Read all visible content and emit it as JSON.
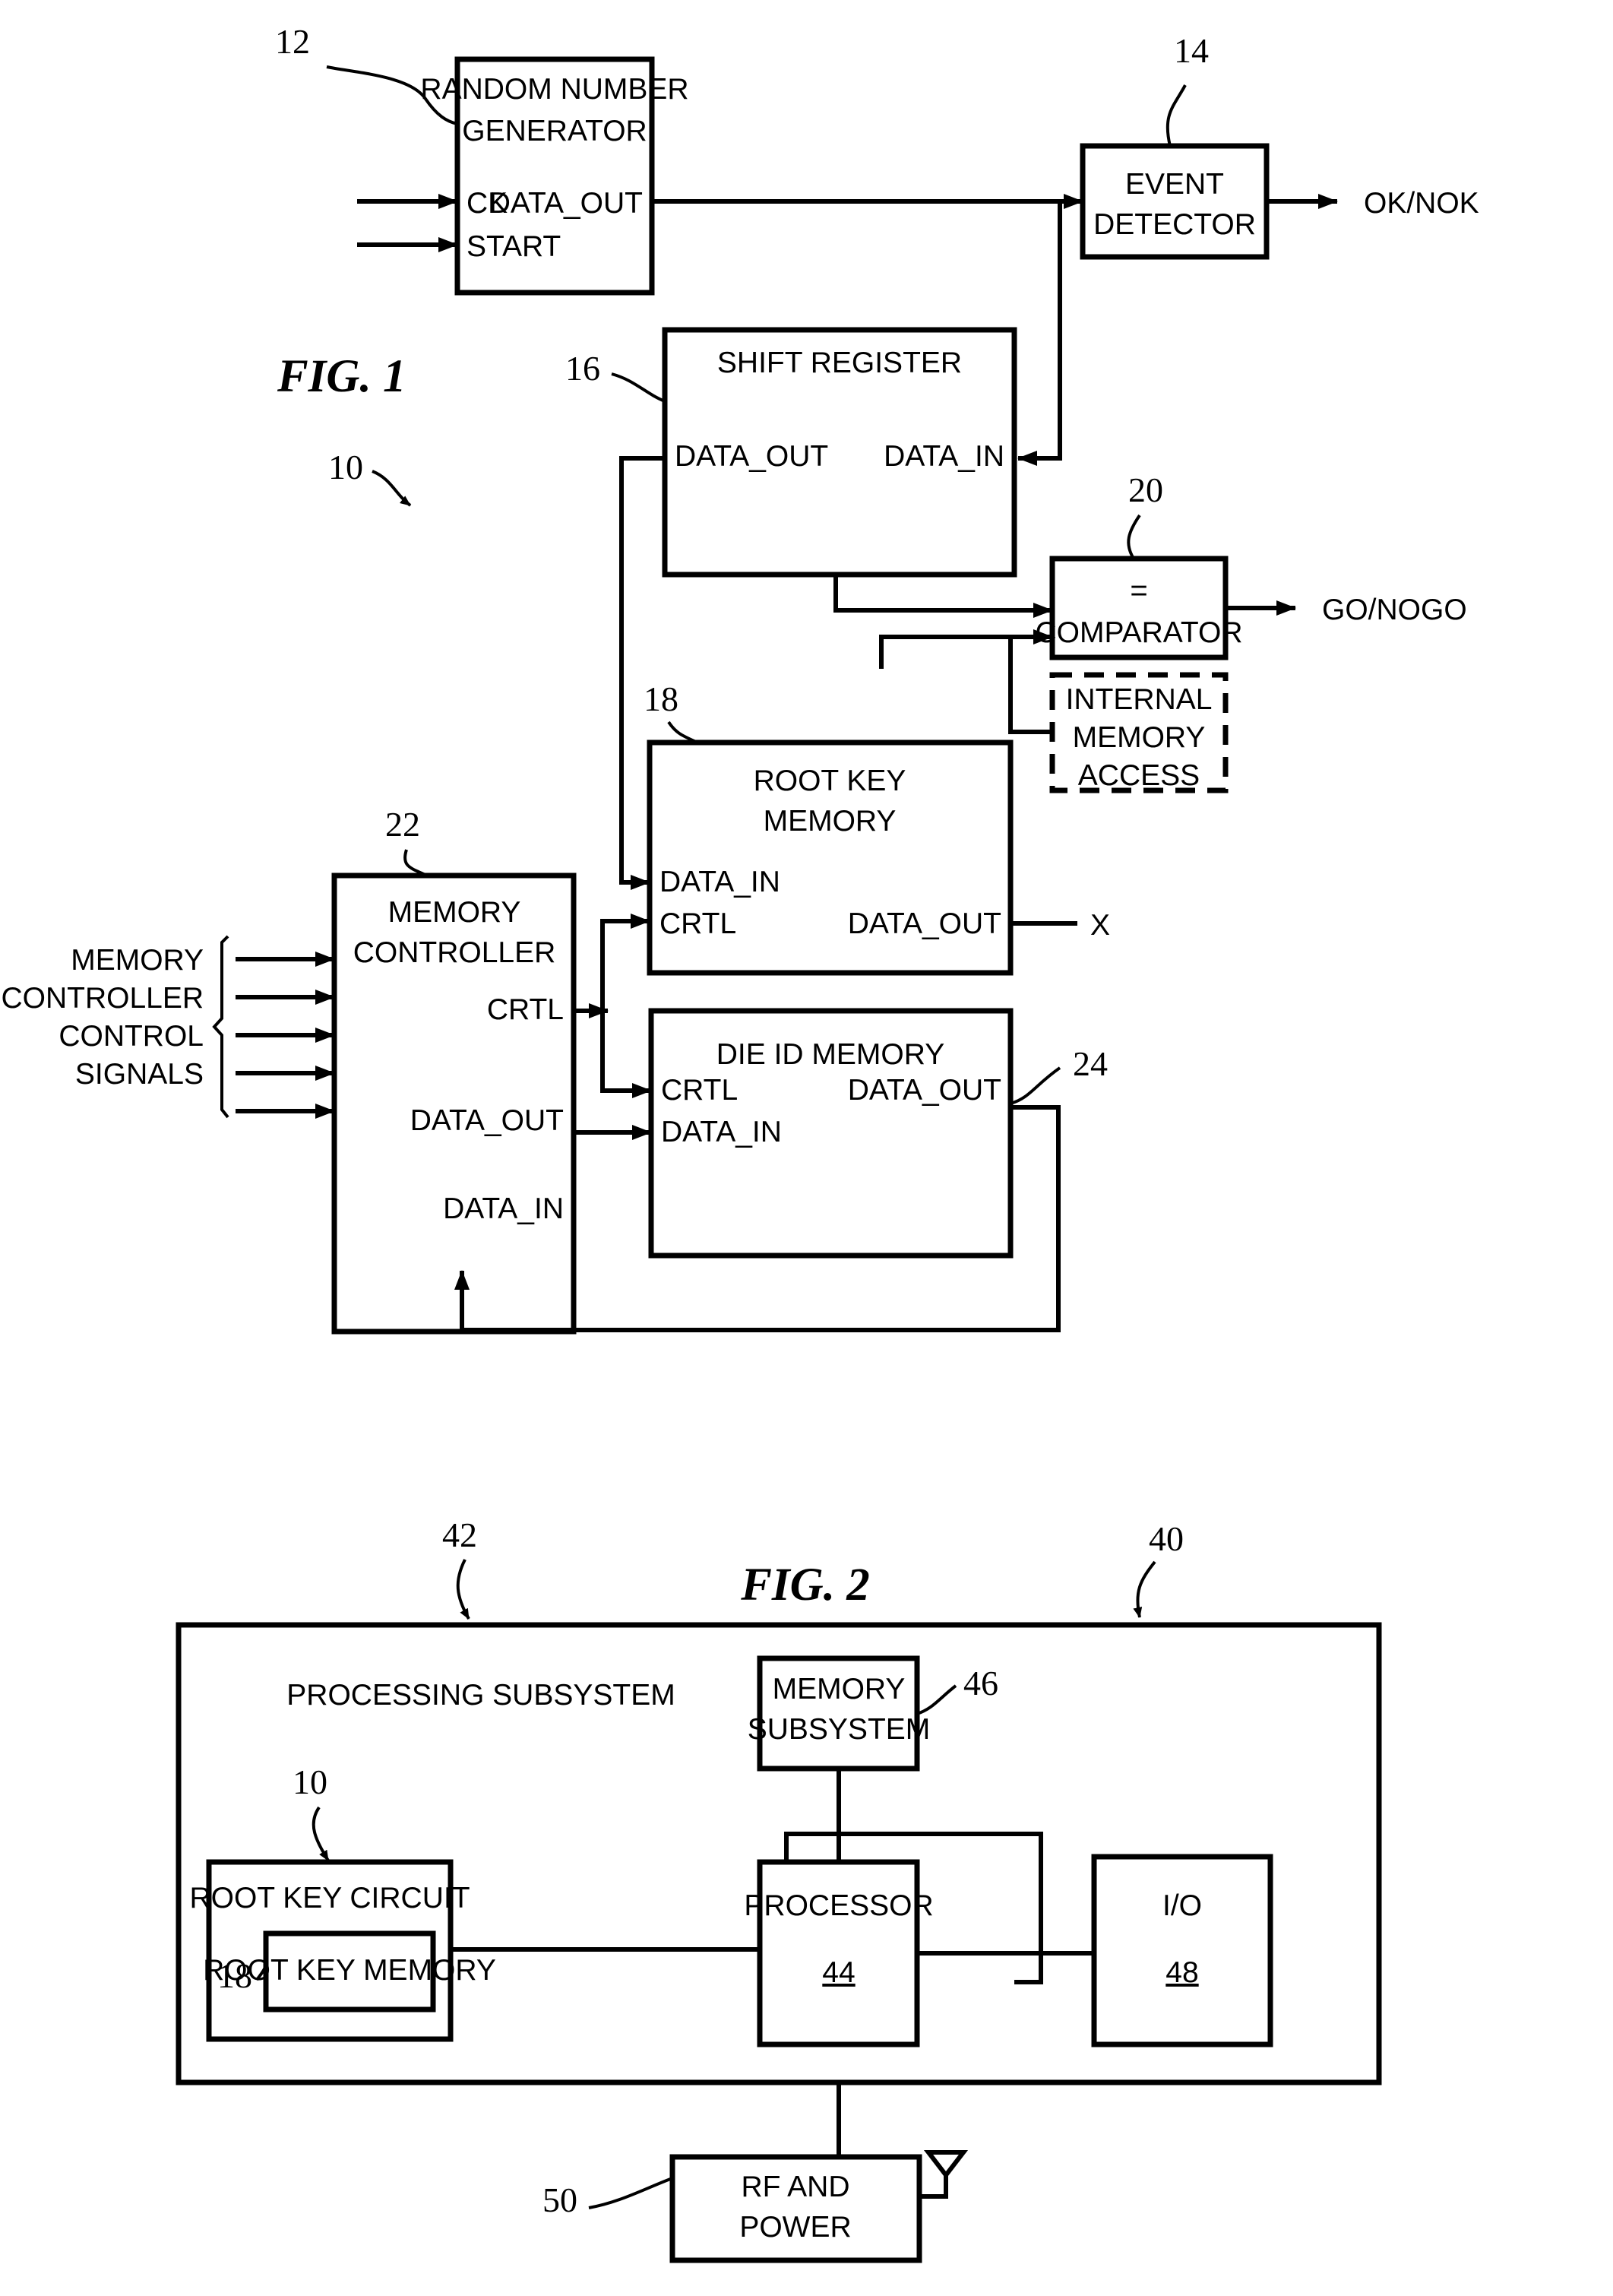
{
  "figures": [
    {
      "id": "fig1",
      "caption": "FIG. 1",
      "ref": "10",
      "blocks": [
        {
          "key": "rng",
          "ref": "12",
          "lines": [
            "RANDOM NUMBER",
            "GENERATOR"
          ],
          "ports": [
            "CK",
            "START",
            "DATA_OUT"
          ]
        },
        {
          "key": "evt",
          "ref": "14",
          "lines": [
            "EVENT",
            "DETECTOR"
          ],
          "output": "OK/NOK"
        },
        {
          "key": "shift",
          "ref": "16",
          "lines": [
            "SHIFT REGISTER"
          ],
          "ports": [
            "DATA_OUT",
            "DATA_IN"
          ]
        },
        {
          "key": "comp",
          "ref": "20",
          "lines": [
            "=",
            "COMPARATOR"
          ],
          "output": "GO/NOGO"
        },
        {
          "key": "ima",
          "ref": "",
          "lines": [
            "INTERNAL",
            "MEMORY",
            "ACCESS"
          ],
          "dashed": true
        },
        {
          "key": "rkm",
          "ref": "18",
          "lines": [
            "ROOT KEY",
            "MEMORY"
          ],
          "ports": [
            "DATA_IN",
            "CRTL",
            "DATA_OUT"
          ],
          "output": "X"
        },
        {
          "key": "mc",
          "ref": "22",
          "lines": [
            "MEMORY",
            "CONTROLLER"
          ],
          "ports": [
            "CRTL",
            "DATA_OUT",
            "DATA_IN"
          ]
        },
        {
          "key": "did",
          "ref": "24",
          "lines": [
            "DIE ID MEMORY"
          ],
          "ports": [
            "CRTL",
            "DATA_OUT",
            "DATA_IN"
          ]
        }
      ],
      "bus_label": [
        "MEMORY",
        "CONTROLLER",
        "CONTROL",
        "SIGNALS"
      ],
      "bus_arrow_count": 5
    },
    {
      "id": "fig2",
      "caption": "FIG. 2",
      "ref": "40",
      "blocks": [
        {
          "key": "proc_sub",
          "ref": "42",
          "lines": [
            "PROCESSING SUBSYSTEM"
          ]
        },
        {
          "key": "memsub",
          "ref": "46",
          "lines": [
            "MEMORY",
            "SUBSYSTEM"
          ]
        },
        {
          "key": "rkc",
          "ref": "10",
          "lines": [
            "ROOT KEY CIRCUIT"
          ]
        },
        {
          "key": "rkm2",
          "ref": "18",
          "lines": [
            "ROOT KEY MEMORY"
          ]
        },
        {
          "key": "proc",
          "ref": "",
          "lines": [
            "PROCESSOR"
          ],
          "num": "44"
        },
        {
          "key": "io",
          "ref": "",
          "lines": [
            "I/O"
          ],
          "num": "48"
        },
        {
          "key": "rf",
          "ref": "50",
          "lines": [
            "RF AND",
            "POWER"
          ]
        }
      ]
    }
  ],
  "labels": {
    "fig1_caption": "FIG. 1",
    "fig1_ref": "10",
    "fig2_caption": "FIG. 2",
    "fig2_ref": "40",
    "rng_title1": "RANDOM NUMBER",
    "rng_title2": "GENERATOR",
    "rng_ref": "12",
    "rng_ck": "CK",
    "rng_start": "START",
    "rng_dataout": "DATA_OUT",
    "evt_title1": "EVENT",
    "evt_title2": "DETECTOR",
    "evt_ref": "14",
    "evt_out": "OK/NOK",
    "shift_title": "SHIFT REGISTER",
    "shift_ref": "16",
    "shift_dataout": "DATA_OUT",
    "shift_datain": "DATA_IN",
    "comp_eq": "=",
    "comp_title": "COMPARATOR",
    "comp_ref": "20",
    "comp_out": "GO/NOGO",
    "ima_l1": "INTERNAL",
    "ima_l2": "MEMORY",
    "ima_l3": "ACCESS",
    "rkm_title1": "ROOT KEY",
    "rkm_title2": "MEMORY",
    "rkm_ref": "18",
    "rkm_datain": "DATA_IN",
    "rkm_crtl": "CRTL",
    "rkm_dataout": "DATA_OUT",
    "rkm_x": "X",
    "mc_title1": "MEMORY",
    "mc_title2": "CONTROLLER",
    "mc_ref": "22",
    "mc_crtl": "CRTL",
    "mc_dataout": "DATA_OUT",
    "mc_datain": "DATA_IN",
    "did_title": "DIE ID MEMORY",
    "did_ref": "24",
    "did_crtl": "CRTL",
    "did_dataout": "DATA_OUT",
    "did_datain": "DATA_IN",
    "bus1": "MEMORY",
    "bus2": "CONTROLLER",
    "bus3": "CONTROL",
    "bus4": "SIGNALS",
    "ps_title": "PROCESSING SUBSYSTEM",
    "ps_ref": "42",
    "ms_title1": "MEMORY",
    "ms_title2": "SUBSYSTEM",
    "ms_ref": "46",
    "rkc_title": "ROOT KEY CIRCUIT",
    "rkc_ref": "10",
    "rkm2_title": "ROOT KEY MEMORY",
    "rkm2_ref": "18",
    "proc_title": "PROCESSOR",
    "proc_num": "44",
    "io_title": "I/O",
    "io_num": "48",
    "rf_title1": "RF AND",
    "rf_title2": "POWER",
    "rf_ref": "50"
  }
}
